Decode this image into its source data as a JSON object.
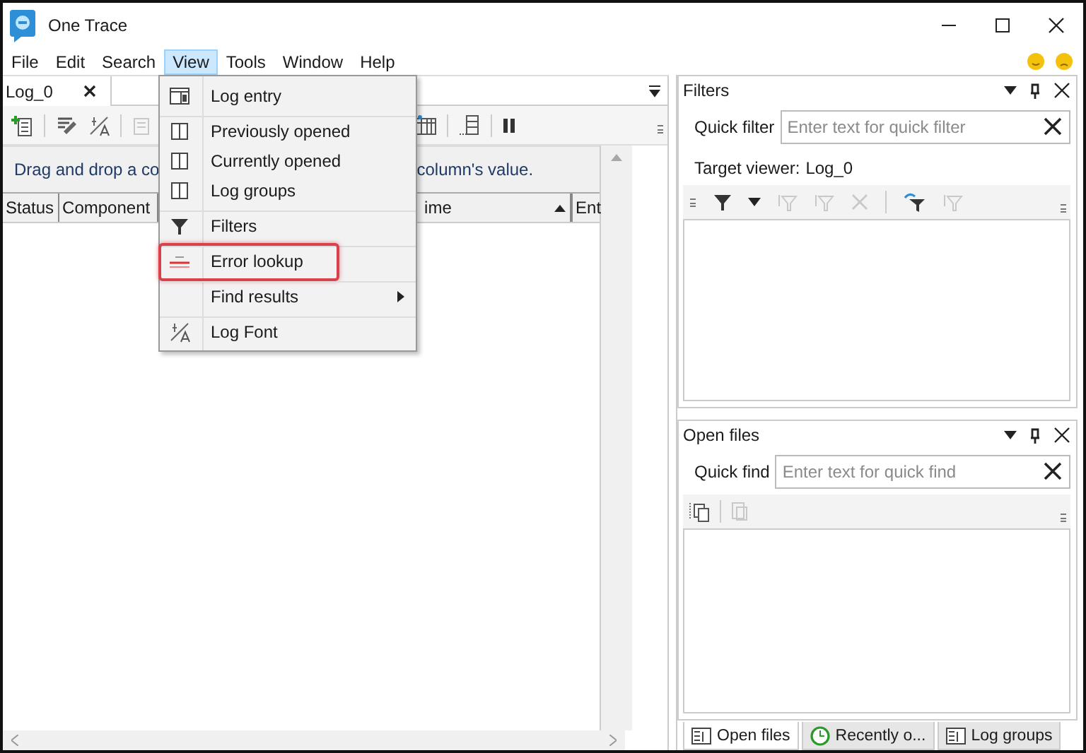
{
  "window": {
    "title": "One Trace"
  },
  "menubar": [
    {
      "label": "File",
      "selected": false
    },
    {
      "label": "Edit",
      "selected": false
    },
    {
      "label": "Search",
      "selected": false
    },
    {
      "label": "View",
      "selected": true
    },
    {
      "label": "Tools",
      "selected": false
    },
    {
      "label": "Window",
      "selected": false
    },
    {
      "label": "Help",
      "selected": false
    }
  ],
  "document_tabs": [
    {
      "label": "Log_0",
      "selected": true
    }
  ],
  "group_panel": {
    "text_start": "Drag and drop a co",
    "text_end": "column's value."
  },
  "log_table": {
    "columns": [
      {
        "label": "Status",
        "sorted": false
      },
      {
        "label": "Component",
        "sorted": false
      },
      {
        "label": "ime",
        "sorted": true
      },
      {
        "label": "Ent",
        "sorted": false
      }
    ]
  },
  "view_menu": {
    "items": [
      {
        "label": "Log entry",
        "separator_before": false,
        "submenu": false,
        "highlighted": false
      },
      {
        "label": "Previously opened",
        "separator_before": true,
        "submenu": false,
        "highlighted": false
      },
      {
        "label": "Currently opened",
        "separator_before": false,
        "submenu": false,
        "highlighted": false
      },
      {
        "label": "Log groups",
        "separator_before": false,
        "submenu": false,
        "highlighted": false
      },
      {
        "label": "Filters",
        "separator_before": true,
        "submenu": false,
        "highlighted": false
      },
      {
        "label": "Error lookup",
        "separator_before": true,
        "submenu": false,
        "highlighted": true
      },
      {
        "label": "Find results",
        "separator_before": true,
        "submenu": true,
        "highlighted": false
      },
      {
        "label": "Log Font",
        "separator_before": true,
        "submenu": false,
        "highlighted": false
      }
    ]
  },
  "filters_panel": {
    "title": "Filters",
    "quick_filter": {
      "label": "Quick filter",
      "placeholder": "Enter text for quick filter"
    },
    "target_viewer": {
      "label": "Target viewer:",
      "value": "Log_0"
    }
  },
  "open_files_panel": {
    "title": "Open files",
    "quick_find": {
      "label": "Quick find",
      "placeholder": "Enter text for quick find"
    }
  },
  "bottom_tabs": [
    {
      "label": "Open files",
      "selected": true
    },
    {
      "label": "Recently o...",
      "selected": false
    },
    {
      "label": "Log groups",
      "selected": false
    }
  ]
}
